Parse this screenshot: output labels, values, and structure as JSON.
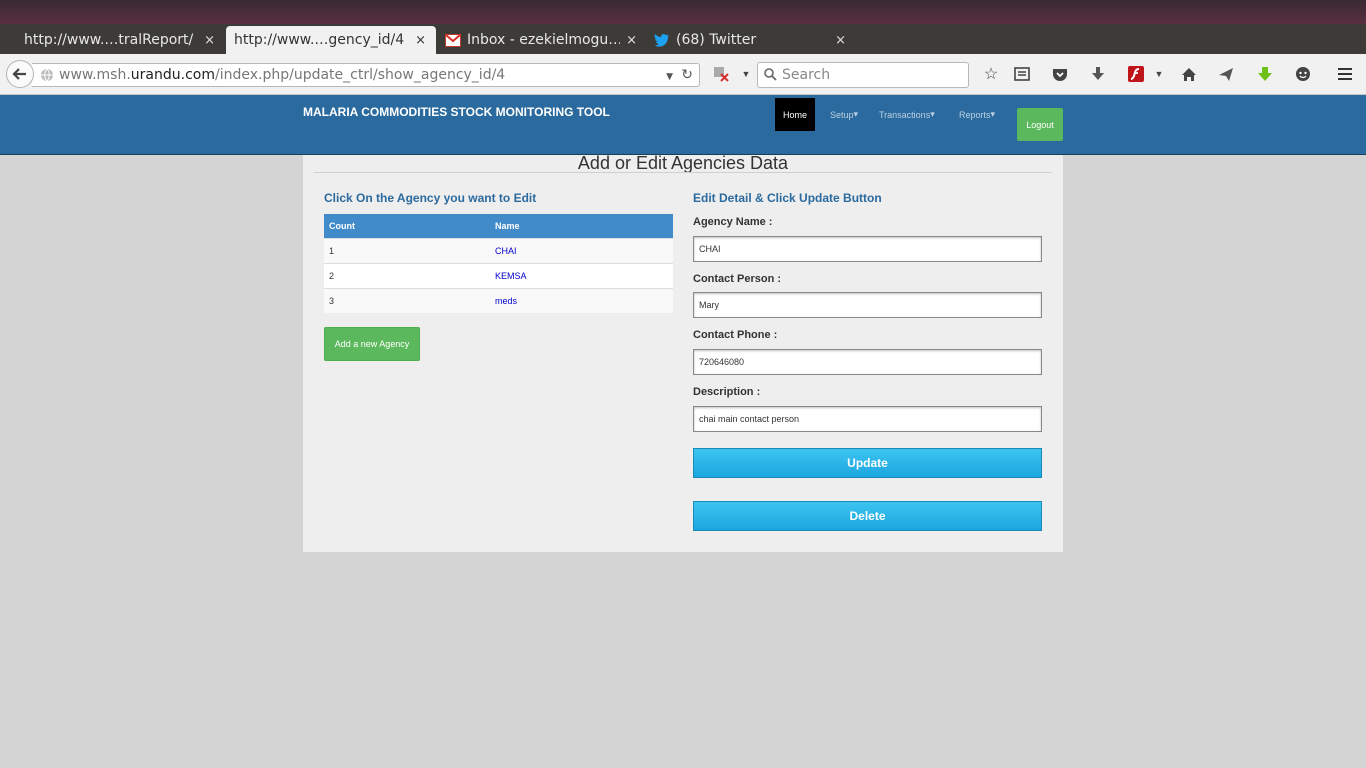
{
  "browser": {
    "tabs": [
      {
        "title": "http://www.…tralReport/",
        "active": false
      },
      {
        "title": "http://www.…gency_id/4",
        "active": true
      },
      {
        "title": "Inbox - ezekielmogu…",
        "active": false,
        "icon": "gmail-icon"
      },
      {
        "title": "(68) Twitter",
        "active": false,
        "icon": "twitter-icon"
      }
    ],
    "close_glyph": "×",
    "url": {
      "prefix": "www.msh.",
      "host": "urandu.com",
      "path": "/index.php/update_ctrl/show_agency_id/4"
    },
    "search_placeholder": "Search"
  },
  "app": {
    "brand": "MALARIA COMMODITIES STOCK MONITORING TOOL",
    "nav": [
      {
        "label": "Home",
        "active": true
      },
      {
        "label": "Setup",
        "caret": true
      },
      {
        "label": "Transactions",
        "caret": true
      },
      {
        "label": "Reports",
        "caret": true
      }
    ],
    "logout_label": "Logout"
  },
  "page": {
    "title": "Add or Edit Agencies Data",
    "left_heading": "Click On the Agency you want to Edit",
    "table": {
      "headers": [
        "Count",
        "Name"
      ],
      "rows": [
        {
          "count": "1",
          "name": "CHAI"
        },
        {
          "count": "2",
          "name": "KEMSA"
        },
        {
          "count": "3",
          "name": "meds"
        }
      ]
    },
    "add_button": "Add a new Agency",
    "right_heading": "Edit Detail & Click Update Button",
    "form": {
      "agency_name_label": "Agency Name :",
      "agency_name_value": "CHAI",
      "contact_person_label": "Contact Person :",
      "contact_person_value": "Mary",
      "contact_phone_label": "Contact Phone :",
      "contact_phone_value": "720646080",
      "description_label": "Description :",
      "description_value": "chai main contact person"
    },
    "update_label": "Update",
    "delete_label": "Delete"
  },
  "colors": {
    "header_bg": "#2b6a9e",
    "table_header_bg": "#428bca",
    "success_green": "#5cb85c",
    "action_blue": "#1ba6e0"
  }
}
